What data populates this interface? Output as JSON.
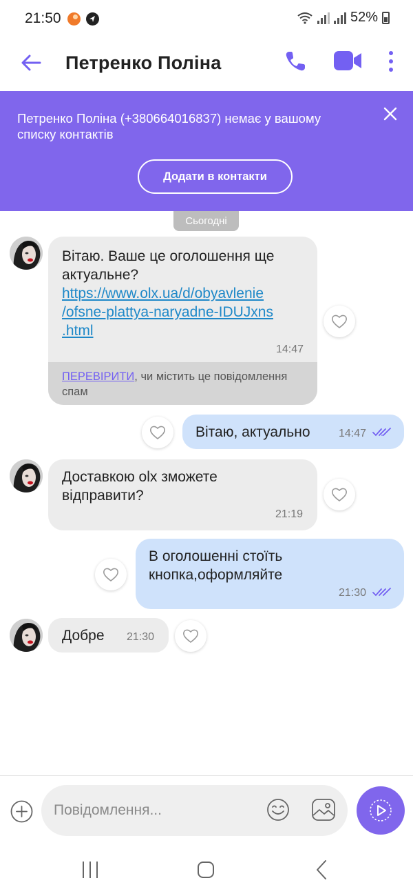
{
  "status_bar": {
    "time": "21:50",
    "battery": "52%"
  },
  "header": {
    "contact_name": "Петренко Поліна",
    "icons": [
      "back-arrow-icon",
      "phone-icon",
      "video-camera-icon",
      "more-vertical-icon"
    ]
  },
  "banner": {
    "text": "Петренко Поліна (+380664016837) немає у вашому списку контактів",
    "add_button": "Додати в контакти",
    "color": "#8066ec"
  },
  "date_label": "Сьогодні",
  "messages": [
    {
      "direction": "incoming",
      "text": "Вітаю. Ваше це оголошення ще актуальне?",
      "link": "https://www.olx.ua/d/obyavlenie/ofsne-plattya-naryadne-IDUJxns.html",
      "link_lines": [
        "https://www.olx.ua/d/obyavlenie",
        "/ofsne-plattya-naryadne-IDUJxns",
        ".html"
      ],
      "time": "14:47",
      "spam_check": {
        "link_text": "ПЕРЕВІРИТИ",
        "rest_text": ", чи містить це повідомлення спам"
      }
    },
    {
      "direction": "outgoing",
      "text": "Вітаю, актуально",
      "time": "14:47"
    },
    {
      "direction": "incoming",
      "text": "Доставкою olx зможете відправити?",
      "time": "21:19"
    },
    {
      "direction": "outgoing",
      "text": "В оголошенні стоїть кнопка,оформляйте",
      "time": "21:30"
    },
    {
      "direction": "incoming",
      "text": "Добре",
      "time": "21:30"
    }
  ],
  "composer": {
    "placeholder": "Повідомлення..."
  },
  "colors": {
    "accent": "#7360f2",
    "incoming_bubble": "#ececec",
    "outgoing_bubble": "#cfe2fb"
  }
}
